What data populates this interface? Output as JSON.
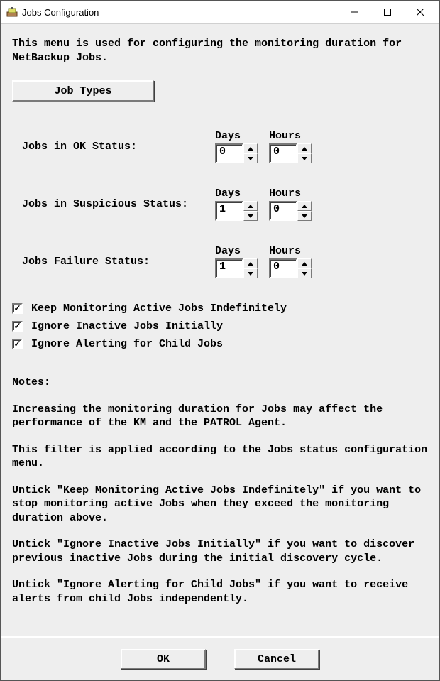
{
  "window": {
    "title": "Jobs Configuration"
  },
  "intro": "This menu is used for configuring the monitoring duration for NetBackup Jobs.",
  "jobTypesBtn": "Job Types",
  "columns": {
    "days": "Days",
    "hours": "Hours"
  },
  "rows": {
    "ok": {
      "label": "Jobs in OK Status:",
      "days": "0",
      "hours": "0"
    },
    "suspicious": {
      "label": "Jobs in Suspicious Status:",
      "days": "1",
      "hours": "0"
    },
    "failure": {
      "label": "Jobs Failure Status:",
      "days": "1",
      "hours": "0"
    }
  },
  "checks": {
    "keepActive": {
      "label": "Keep Monitoring Active Jobs Indefinitely",
      "checked": "✓"
    },
    "ignoreInact": {
      "label": "Ignore Inactive Jobs Initially",
      "checked": "✓"
    },
    "ignoreChild": {
      "label": "Ignore Alerting for Child Jobs",
      "checked": "✓"
    }
  },
  "notes": {
    "heading": "Notes:",
    "p1": "Increasing the monitoring duration for Jobs may affect the performance of the KM and the PATROL Agent.",
    "p2": "This filter is applied according to the Jobs status configuration menu.",
    "p3": "Untick \"Keep Monitoring Active Jobs Indefinitely\" if you want to stop monitoring active Jobs when they exceed the monitoring duration above.",
    "p4": "Untick \"Ignore Inactive Jobs Initially\" if you want to discover previous inactive Jobs during the initial discovery cycle.",
    "p5": "Untick \"Ignore Alerting for Child Jobs\" if you want to receive alerts from child Jobs independently."
  },
  "footer": {
    "ok": "OK",
    "cancel": "Cancel"
  }
}
